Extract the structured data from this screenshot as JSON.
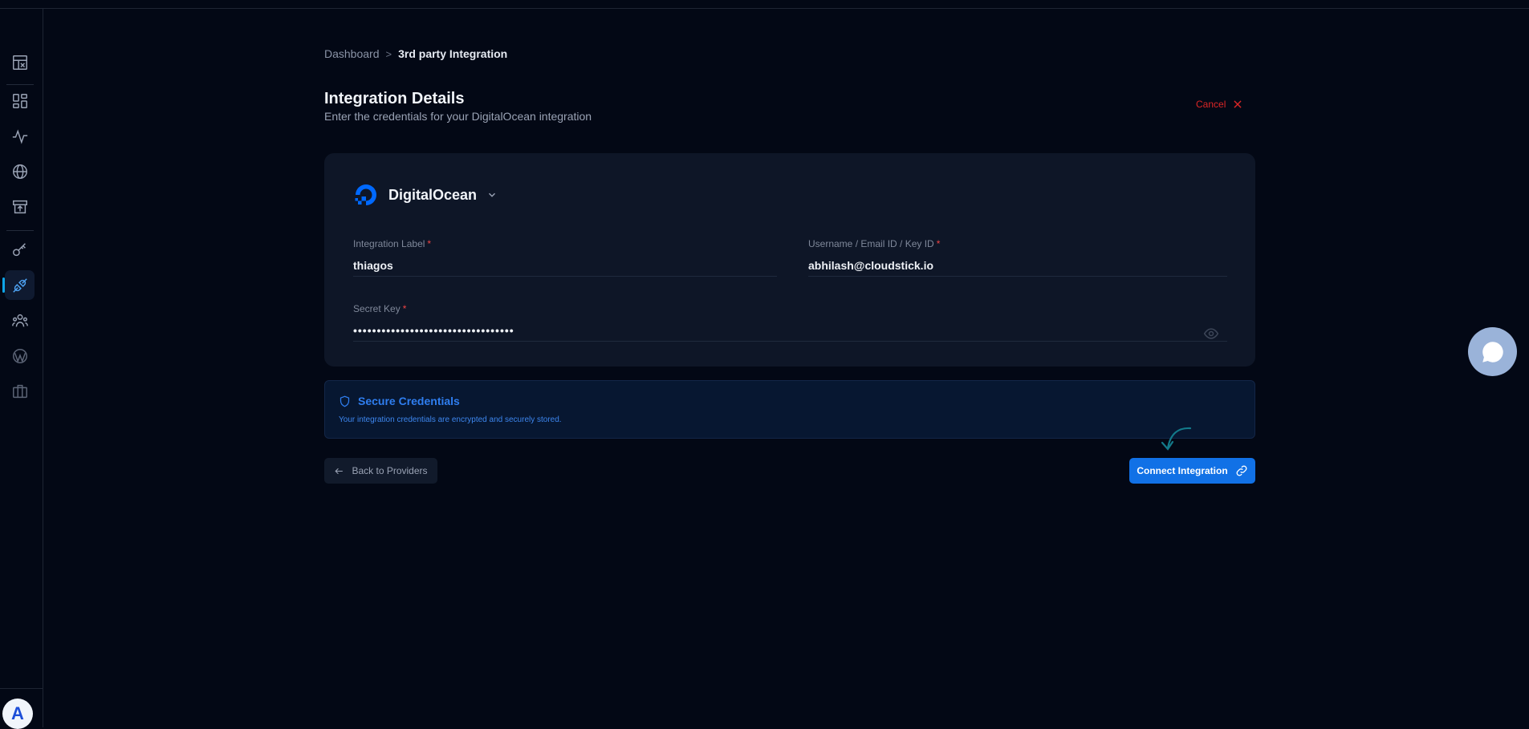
{
  "breadcrumb": {
    "root": "Dashboard",
    "separator": ">",
    "current": "3rd party Integration"
  },
  "header": {
    "title": "Integration Details",
    "subtitle": "Enter the credentials for your DigitalOcean integration",
    "cancel_label": "Cancel"
  },
  "provider": {
    "name": "DigitalOcean",
    "logo_icon": "digitalocean-logo",
    "brand_color": "#0069ff"
  },
  "form": {
    "label_field": {
      "label": "Integration Label",
      "required_mark": "*",
      "value": "thiagos"
    },
    "username_field": {
      "label": "Username / Email ID / Key ID",
      "required_mark": "*",
      "value": "abhilash@cloudstick.io"
    },
    "secret_field": {
      "label": "Secret Key",
      "required_mark": "*",
      "value": "secretkeyvalue12345678901234567890"
    }
  },
  "secure_notice": {
    "title": "Secure Credentials",
    "text": "Your integration credentials are encrypted and securely stored."
  },
  "actions": {
    "back_label": "Back to Providers",
    "connect_label": "Connect Integration"
  },
  "sidebar": {
    "items": [
      {
        "icon": "layout-icon"
      },
      {
        "icon": "dashboard-icon"
      },
      {
        "icon": "activity-icon"
      },
      {
        "icon": "globe-icon"
      },
      {
        "icon": "store-icon"
      },
      {
        "icon": "key-icon"
      },
      {
        "icon": "plug-icon",
        "active": true
      },
      {
        "icon": "team-icon"
      },
      {
        "icon": "wordpress-icon"
      },
      {
        "icon": "briefcase-icon"
      }
    ],
    "avatar_initial": "A"
  },
  "colors": {
    "background": "#030815",
    "card": "#0e1627",
    "accent": "#1171e6",
    "danger": "#dc2626",
    "active_indicator": "#0ea5e9"
  }
}
